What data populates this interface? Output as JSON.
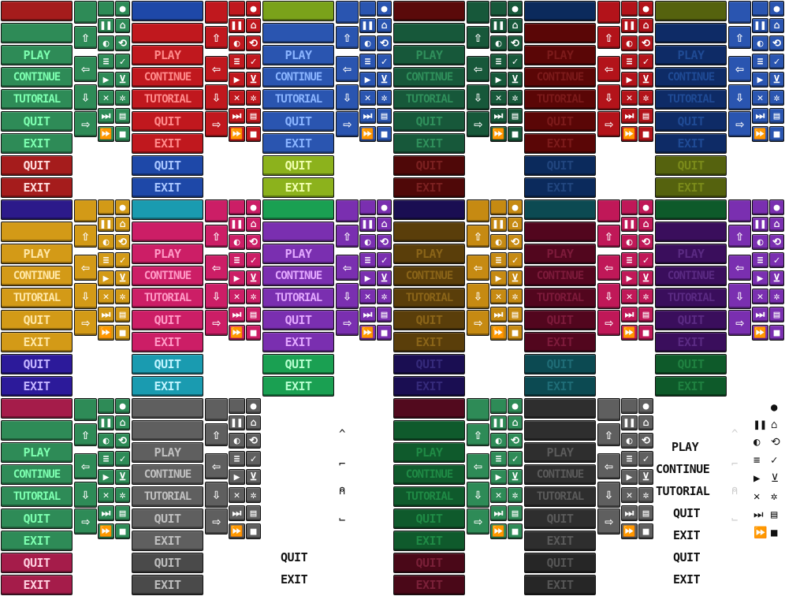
{
  "labels": {
    "play": "PLAY",
    "continue": "CONTINUE",
    "tutorial": "TUTORIAL",
    "quit": "QUIT",
    "exit": "EXIT"
  },
  "icons": {
    "dot": "●",
    "up": "⇧",
    "pause": "❚❚",
    "home": "⌂",
    "sound": "◐",
    "back": "⟲",
    "left": "⇦",
    "menu": "≡",
    "check": "✓",
    "playtri": "▶",
    "cart": "⊻",
    "down": "⇩",
    "close": "✕",
    "gear": "✲",
    "right": "⇨",
    "skip": "⏭",
    "save": "▤",
    "ffwd": "⏩",
    "stop": "■",
    "caret": "^",
    "squig1": "⌐",
    "squig2": "⍝",
    "squig3": "⌙"
  },
  "sheets": [
    {
      "main": "#2e8b57",
      "text": "#7dffb0",
      "titlebar": "#a51c1c",
      "alt": "#a51c1c",
      "alttext": "#ffdddd",
      "alt2": "#a51c1c",
      "alt2text": "#ffdddd",
      "icon": "#2e8b57"
    },
    {
      "main": "#c0181e",
      "text": "#ff8a8a",
      "titlebar": "#1e48a8",
      "alt": "#1e48a8",
      "alttext": "#a9c6ff",
      "alt2": "#1e48a8",
      "alt2text": "#a9c6ff",
      "icon": "#c0181e"
    },
    {
      "main": "#2a55b0",
      "text": "#8ab4ff",
      "titlebar": "#7aa21a",
      "alt": "#8cb21c",
      "alttext": "#f1ffb0",
      "alt2": "#8cb21c",
      "alt2text": "#f1ffb0",
      "icon": "#2a55b0"
    },
    {
      "main": "#17583a",
      "text": "#2f8f5b",
      "titlebar": "#5a0a0a",
      "alt": "#4f0808",
      "alttext": "#7a2020",
      "alt2": "#4f0808",
      "alt2text": "#7a2020",
      "icon": "#17583a"
    },
    {
      "main": "#5a0606",
      "text": "#7b1a1a",
      "titlebar": "#0b2a5c",
      "alt": "#0b2a5c",
      "alttext": "#21457e",
      "alt2": "#0b2a5c",
      "alt2text": "#21457e",
      "icon": "#b3131a"
    },
    {
      "main": "#0e2b66",
      "text": "#1f4a94",
      "titlebar": "#55620e",
      "alt": "#55620e",
      "alttext": "#7a8a1a",
      "alt2": "#55620e",
      "alt2text": "#7a8a1a",
      "icon": "#2a55b0"
    },
    {
      "main": "#d39a17",
      "text": "#ffe7a6",
      "titlebar": "#2c1a8a",
      "alt": "#2c1a9a",
      "alttext": "#c4b5ff",
      "alt2": "#2c1a9a",
      "alt2text": "#c4b5ff",
      "icon": "#d39a17"
    },
    {
      "main": "#cc1e66",
      "text": "#ff9ac6",
      "titlebar": "#1a9bb0",
      "alt": "#1a9bb0",
      "alttext": "#c0f4ff",
      "alt2": "#1a9bb0",
      "alt2text": "#c0f4ff",
      "icon": "#cc1e66"
    },
    {
      "main": "#7a2fb0",
      "text": "#e3a8ff",
      "titlebar": "#1aa052",
      "alt": "#1aa052",
      "alttext": "#b8ffd1",
      "alt2": "#1aa052",
      "alt2text": "#b8ffd1",
      "icon": "#7a2fb0"
    },
    {
      "main": "#5a3e0a",
      "text": "#8a6418",
      "titlebar": "#1a0e52",
      "alt": "#1a0e52",
      "alttext": "#352a7a",
      "alt2": "#1a0e52",
      "alt2text": "#352a7a",
      "icon": "#c68a12"
    },
    {
      "main": "#52061e",
      "text": "#7c1a3a",
      "titlebar": "#0c4a52",
      "alt": "#0c4a52",
      "alttext": "#1f6c76",
      "alt2": "#0c4a52",
      "alt2text": "#1f6c76",
      "icon": "#c01858"
    },
    {
      "main": "#3a0e5c",
      "text": "#5a2a82",
      "titlebar": "#0e5a2a",
      "alt": "#0e5a2a",
      "alttext": "#1f8040",
      "alt2": "#0e5a2a",
      "alt2text": "#1f8040",
      "icon": "#7a2fb0"
    },
    {
      "main": "#2e8b57",
      "text": "#7dffb0",
      "titlebar": "#a51c4a",
      "alt": "#a51c4a",
      "alttext": "#ffd0e0",
      "alt2": "#a51c4a",
      "alt2text": "#ffd0e0",
      "icon": "#2e8b57"
    },
    {
      "main": "#5f5f5f",
      "text": "#c0c0c0",
      "titlebar": "#5f5f5f",
      "alt": "#4a4a4a",
      "alttext": "#bdbdbd",
      "alt2": "#4a4a4a",
      "alt2text": "#bdbdbd",
      "icon": "#5f5f5f"
    },
    {
      "main": "#ffffff",
      "text": "#111111",
      "titlebar": "#ffffff",
      "alt": "#ffffff",
      "alttext": "#111111",
      "alt2": "#ffffff",
      "alt2text": "#111111",
      "icon": "#ffffff"
    },
    {
      "main": "#0f5a2c",
      "text": "#1f8a45",
      "titlebar": "#520a1e",
      "alt": "#4a0818",
      "alttext": "#7a2038",
      "alt2": "#4a0818",
      "alt2text": "#7a2038",
      "icon": "#2e8b57"
    },
    {
      "main": "#2e2e2e",
      "text": "#5a5a5a",
      "titlebar": "#2e2e2e",
      "alt": "#262626",
      "alttext": "#555555",
      "alt2": "#262626",
      "alt2text": "#555555",
      "icon": "#5f5f5f"
    },
    {
      "main": "#ffffff",
      "text": "#111111",
      "titlebar": "#ffffff",
      "alt": "#ffffff",
      "alttext": "#111111",
      "alt2": "#ffffff",
      "alt2text": "#111111",
      "icon": "#ffffff"
    }
  ]
}
